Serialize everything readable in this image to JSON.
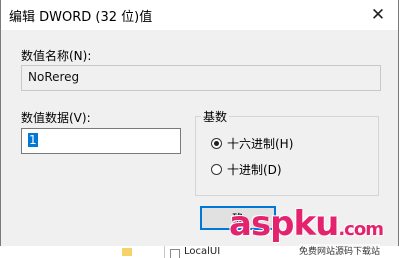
{
  "dialog": {
    "title": "编辑 DWORD (32 位)值",
    "close_glyph": "✕"
  },
  "value_name": {
    "label": "数值名称(N):",
    "value": "NoRereg"
  },
  "value_data": {
    "label": "数值数据(V):",
    "value": "1"
  },
  "base": {
    "title": "基数",
    "options": [
      {
        "label": "十六进制(H)",
        "checked": true
      },
      {
        "label": "十进制(D)",
        "checked": false
      }
    ]
  },
  "buttons": {
    "ok_label": "确"
  },
  "watermark": {
    "logo": "aspku",
    "logo_suffix": ".com",
    "sub": "免费网站源码下载站"
  },
  "background_window": {
    "text": "LocalUI",
    "icons": [
      "folder-icon",
      "registry-value-icon"
    ]
  }
}
